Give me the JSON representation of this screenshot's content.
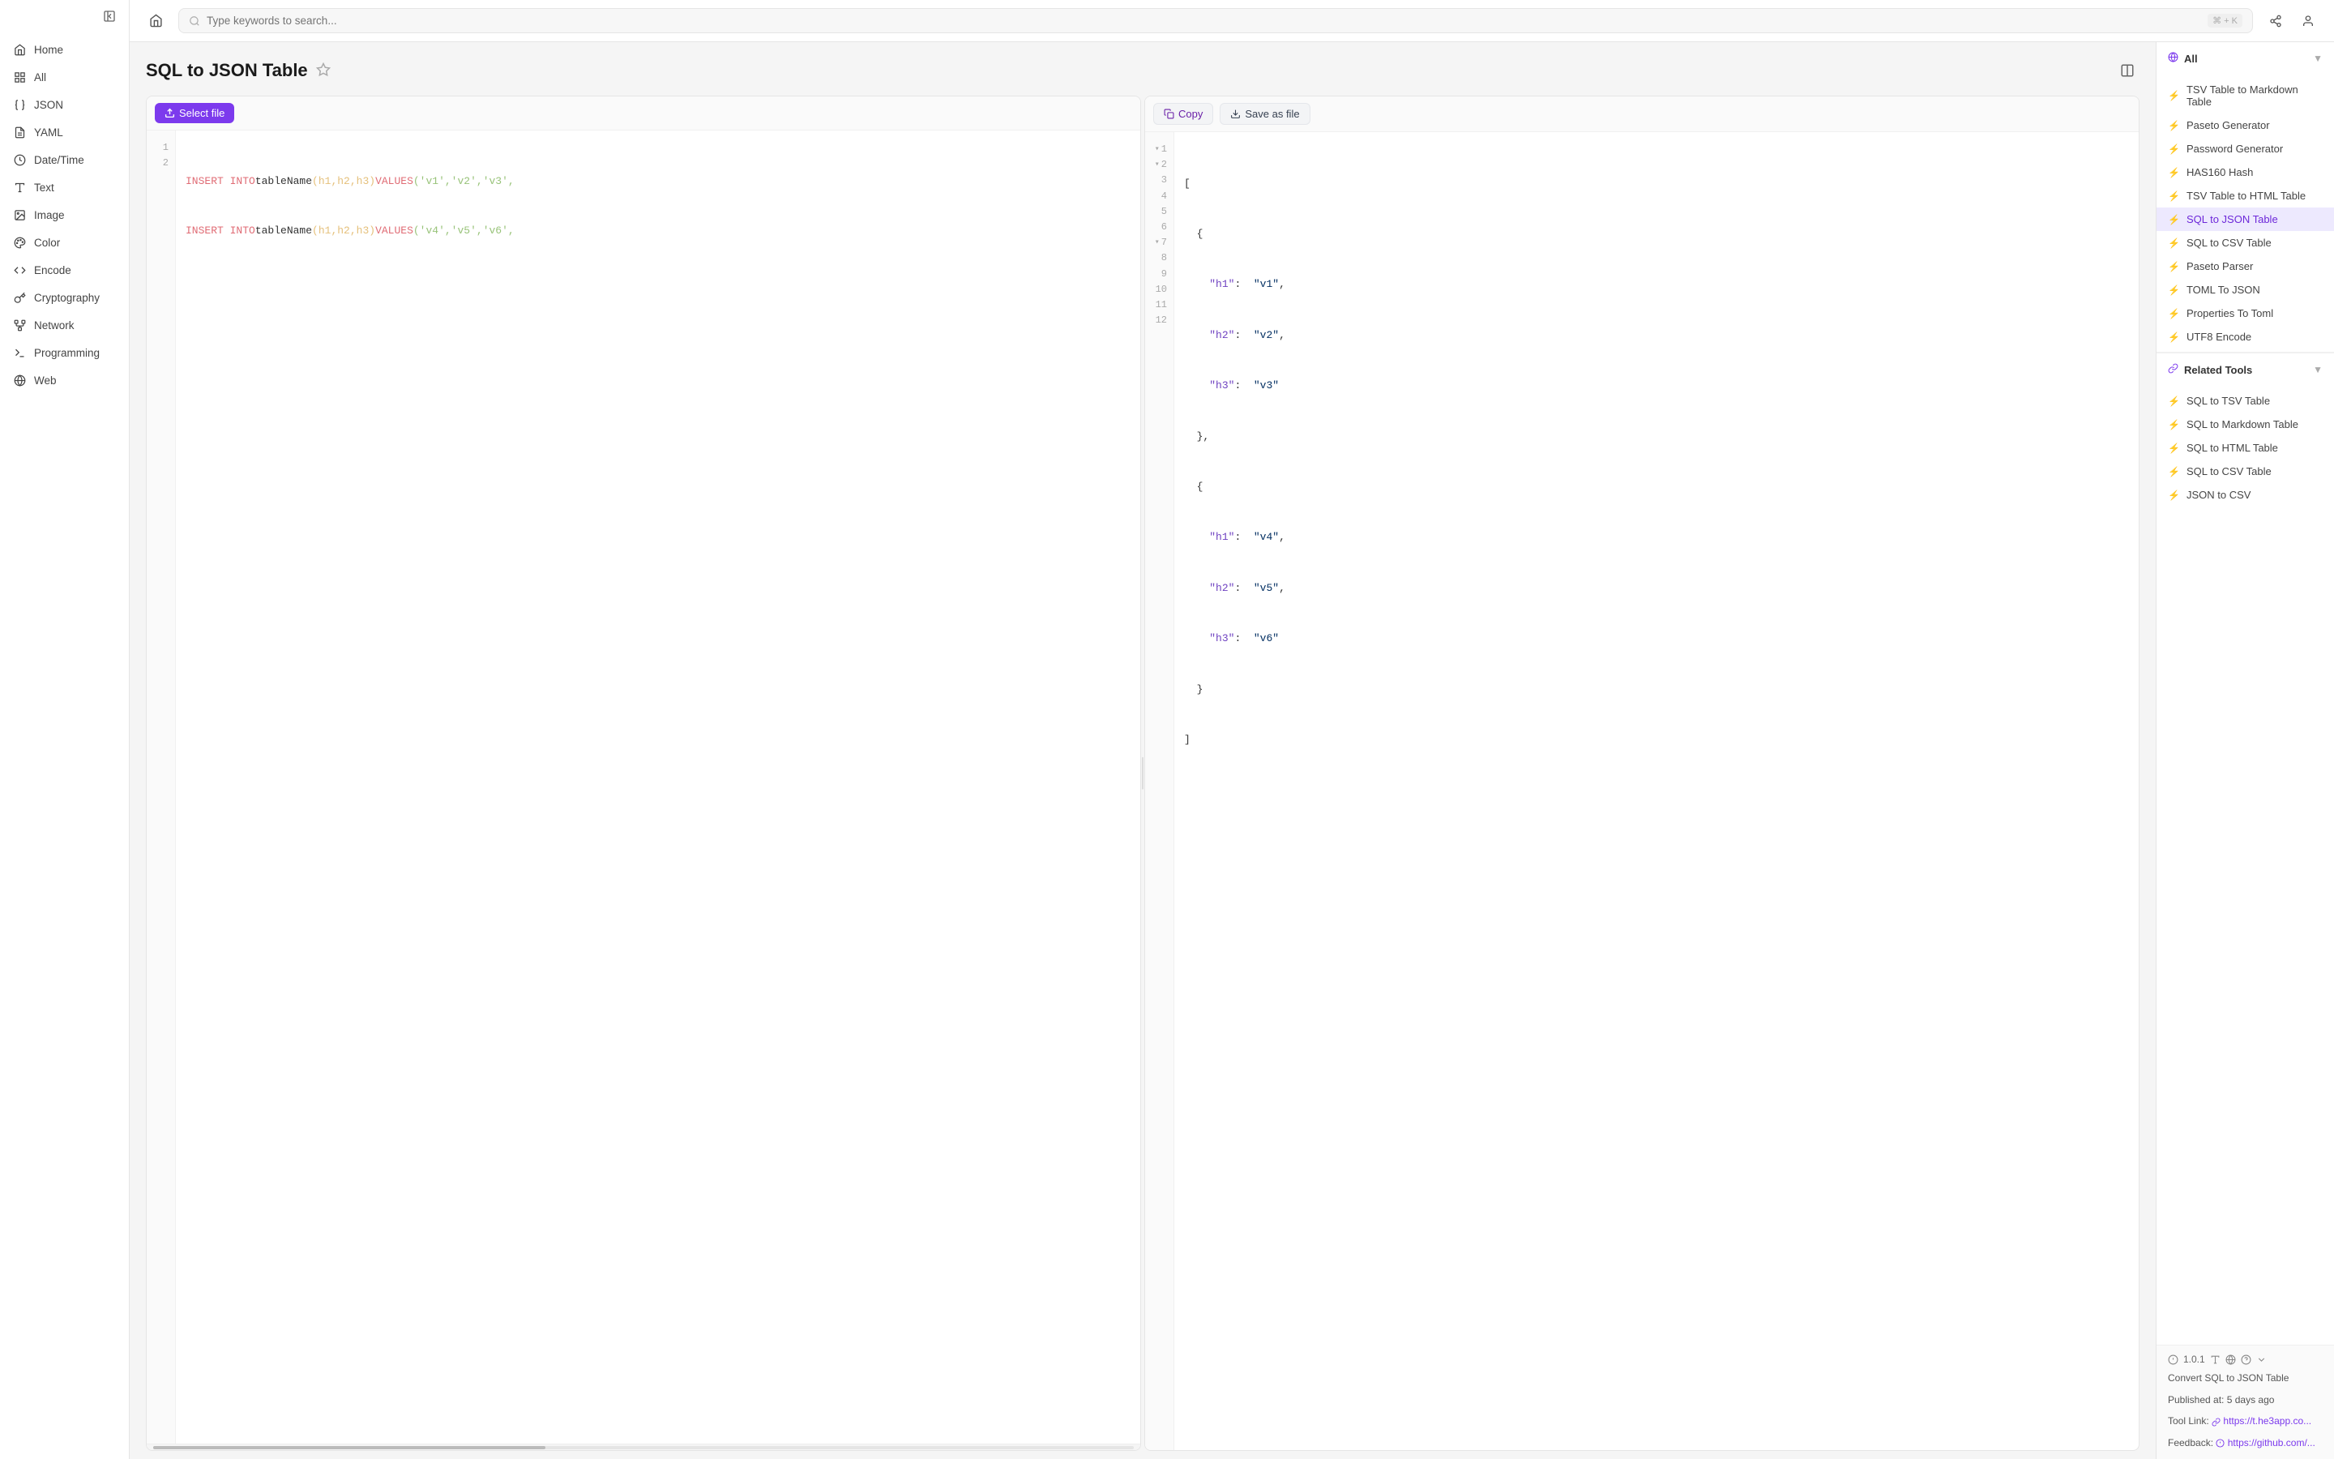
{
  "sidebar": {
    "collapse_label": "Collapse sidebar",
    "items": [
      {
        "id": "home",
        "label": "Home",
        "icon": "home",
        "active": false
      },
      {
        "id": "all",
        "label": "All",
        "icon": "grid",
        "active": false
      },
      {
        "id": "json",
        "label": "JSON",
        "icon": "braces",
        "active": false
      },
      {
        "id": "yaml",
        "label": "YAML",
        "icon": "file-text",
        "active": false
      },
      {
        "id": "datetime",
        "label": "Date/Time",
        "icon": "clock",
        "active": false
      },
      {
        "id": "text",
        "label": "Text",
        "icon": "type",
        "active": false
      },
      {
        "id": "image",
        "label": "Image",
        "icon": "image",
        "active": false
      },
      {
        "id": "color",
        "label": "Color",
        "icon": "palette",
        "active": false
      },
      {
        "id": "encode",
        "label": "Encode",
        "icon": "code",
        "active": false
      },
      {
        "id": "cryptography",
        "label": "Cryptography",
        "icon": "key",
        "active": false
      },
      {
        "id": "network",
        "label": "Network",
        "icon": "network",
        "active": false
      },
      {
        "id": "programming",
        "label": "Programming",
        "icon": "terminal",
        "active": false
      },
      {
        "id": "web",
        "label": "Web",
        "icon": "globe",
        "active": false
      }
    ]
  },
  "topbar": {
    "search_placeholder": "Type keywords to search...",
    "search_shortcut": "⌘ + K"
  },
  "tool": {
    "title": "SQL to JSON Table",
    "input_label": "Select file",
    "output_copy_label": "Copy",
    "output_save_label": "Save as file",
    "input_lines": [
      "INSERT INTO tableName (h1,h2,h3) VALUES ('v1','v2','v3',",
      "INSERT INTO tableName (h1,h2,h3) VALUES ('v4','v5','v6',"
    ],
    "output_json": [
      "[",
      "  {",
      "    \"h1\":  \"v1\",",
      "    \"h2\":  \"v2\",",
      "    \"h3\":  \"v3\"",
      "  },",
      "  {",
      "    \"h1\":  \"v4\",",
      "    \"h2\":  \"v5\",",
      "    \"h3\":  \"v6\"",
      "  }",
      "]"
    ]
  },
  "right_panel": {
    "all_section": {
      "title": "All",
      "items": [
        {
          "id": "tsv-markdown",
          "label": "TSV Table to Markdown Table",
          "active": false
        },
        {
          "id": "paseto-gen",
          "label": "Paseto Generator",
          "active": false
        },
        {
          "id": "password-gen",
          "label": "Password Generator",
          "active": false
        },
        {
          "id": "has160",
          "label": "HAS160 Hash",
          "active": false
        },
        {
          "id": "tsv-html",
          "label": "TSV Table to HTML Table",
          "active": false
        },
        {
          "id": "sql-json",
          "label": "SQL to JSON Table",
          "active": true
        },
        {
          "id": "sql-csv",
          "label": "SQL to CSV Table",
          "active": false
        },
        {
          "id": "paseto-parser",
          "label": "Paseto Parser",
          "active": false
        },
        {
          "id": "toml-json",
          "label": "TOML To JSON",
          "active": false
        },
        {
          "id": "props-toml",
          "label": "Properties To Toml",
          "active": false
        },
        {
          "id": "utf8-encode",
          "label": "UTF8 Encode",
          "active": false
        }
      ]
    },
    "related_section": {
      "title": "Related Tools",
      "items": [
        {
          "id": "sql-tsv",
          "label": "SQL to TSV Table"
        },
        {
          "id": "sql-markdown",
          "label": "SQL to Markdown Table"
        },
        {
          "id": "sql-html",
          "label": "SQL to HTML Table"
        },
        {
          "id": "sql-csv2",
          "label": "SQL to CSV Table"
        },
        {
          "id": "json-csv",
          "label": "JSON to CSV"
        }
      ]
    },
    "version": {
      "number": "1.0.1",
      "description": "Convert SQL to JSON Table",
      "published": "Published at: 5 days ago",
      "tool_link_label": "Tool Link:",
      "tool_link_url": "https://t.he3app.co...",
      "feedback_label": "Feedback:",
      "feedback_url": "https://github.com/..."
    }
  }
}
